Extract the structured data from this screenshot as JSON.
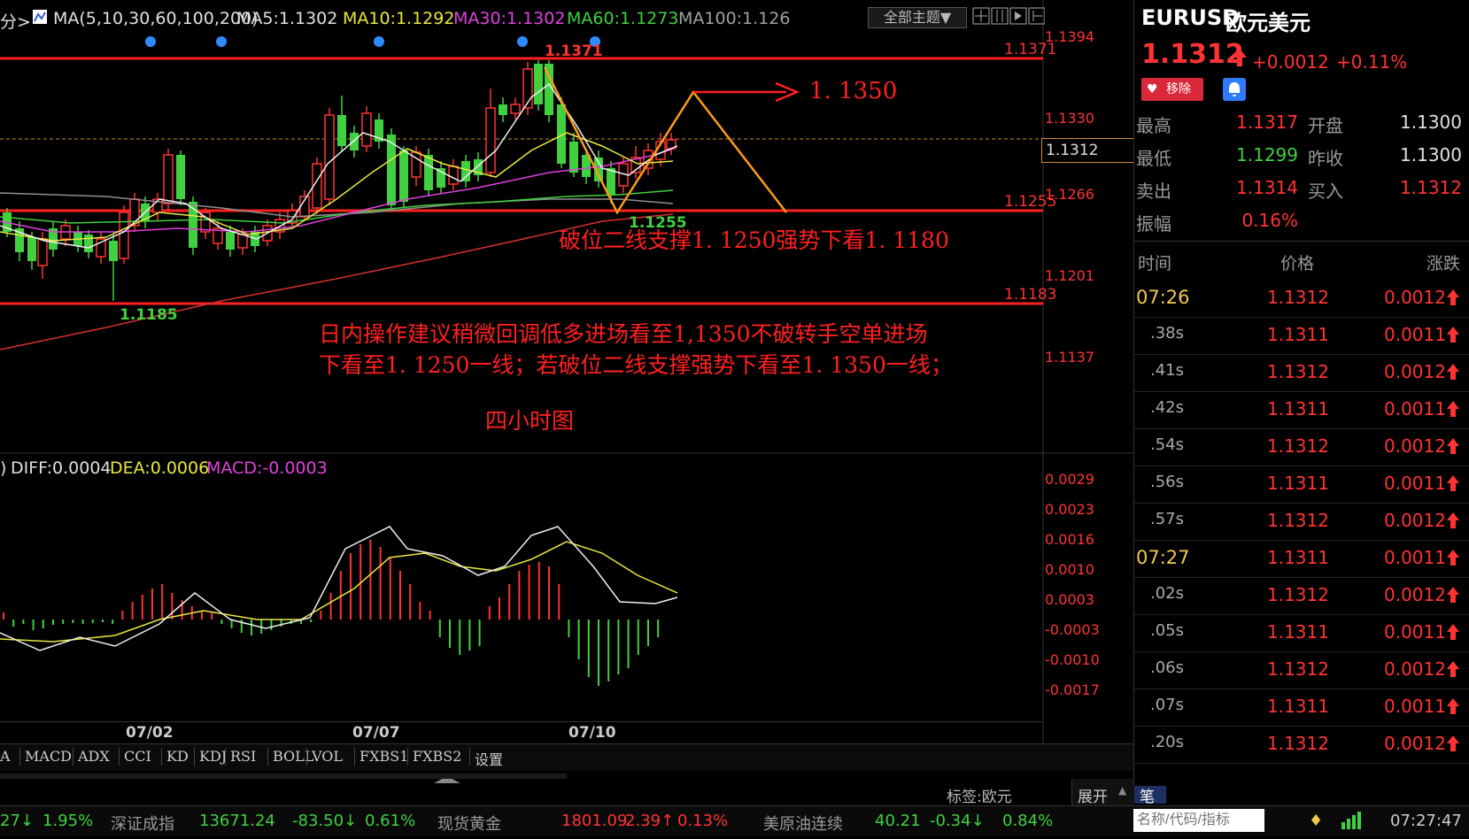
{
  "ma_legend": {
    "prefix": "分>",
    "items": [
      {
        "text": "MA(5,10,30,60,100,200)",
        "color": "#e0e0e0"
      },
      {
        "text": "MA5:1.1302",
        "color": "#e0e0e0"
      },
      {
        "text": "MA10:1.1292",
        "color": "#e8e840"
      },
      {
        "text": "MA30:1.1302",
        "color": "#e040e0"
      },
      {
        "text": "MA60:1.1273",
        "color": "#40d040"
      },
      {
        "text": "MA100:1.126",
        "color": "#a0a0a0"
      }
    ],
    "theme_button": "全部主题▼"
  },
  "macd_legend": {
    "prefix": ")",
    "items": [
      {
        "text": "DIFF:0.0004",
        "color": "#e0e0e0"
      },
      {
        "text": "DEA:0.0006",
        "color": "#e8e840"
      },
      {
        "text": "MACD:-0.0003",
        "color": "#e040e0"
      }
    ]
  },
  "price_axis": [
    "1.1394",
    "1.1330",
    "1.1266",
    "1.1201",
    "1.1137"
  ],
  "current_price_tag": "1.1312",
  "macd_axis": [
    "0.0029",
    "0.0023",
    "0.0016",
    "0.0010",
    "0.0003",
    "-0.0003",
    "-0.0010",
    "-0.0017"
  ],
  "date_axis": [
    "07/02",
    "07/07",
    "07/10"
  ],
  "levels": {
    "top": "1.1371",
    "top_high_label": "1.1371",
    "mid": "1.1255",
    "mid_low_label": "1.1255",
    "bottom": "1.1183",
    "low_label": "1.1185"
  },
  "annotations": {
    "target": "1. 1350",
    "break_note": "破位二线支撑1. 1250强势下看1. 1180",
    "advice_line1": "日内操作建议稍微回调低多进场看至1,1350不破转手空单进场",
    "advice_line2": "下看至1. 1250一线；若破位二线支撑强势下看至1. 1350一线；",
    "chart_type": "四小时图"
  },
  "tabs": [
    "A",
    "MACD",
    "ADX",
    "CCI",
    "KD",
    "KDJ",
    "RSI",
    "BOLL",
    "VOL",
    "FXBS1",
    "FXBS2",
    "设置"
  ],
  "tag_bar": {
    "label": "标签:欧元",
    "expand": "展开",
    "pen": "笔"
  },
  "quote": {
    "symbol": "EURUSD",
    "name": "欧元美元",
    "price": "1.1312",
    "change": "+0.0012",
    "change_pct": "+0.11%",
    "remove_btn": "移除",
    "stats": [
      {
        "label": "最高",
        "value": "1.1317",
        "color": "#ff3333",
        "label2": "开盘",
        "value2": "1.1300",
        "color2": "#e0e0e0"
      },
      {
        "label": "最低",
        "value": "1.1299",
        "color": "#40d040",
        "label2": "昨收",
        "value2": "1.1300",
        "color2": "#e0e0e0"
      },
      {
        "label": "卖出",
        "value": "1.1314",
        "color": "#ff3333",
        "label2": "买入",
        "value2": "1.1312",
        "color2": "#ff3333"
      },
      {
        "label": "振幅",
        "value": "0.16%",
        "color": "#ff3333",
        "label2": "",
        "value2": "",
        "color2": "#e0e0e0"
      }
    ]
  },
  "ticks_header": {
    "time": "时间",
    "price": "价格",
    "change": "涨跌"
  },
  "ticks": [
    {
      "time": "07:26",
      "major": true,
      "price": "1.1312",
      "change": "0.0012"
    },
    {
      "time": ".38s",
      "major": false,
      "price": "1.1311",
      "change": "0.0011"
    },
    {
      "time": ".41s",
      "major": false,
      "price": "1.1312",
      "change": "0.0012"
    },
    {
      "time": ".42s",
      "major": false,
      "price": "1.1311",
      "change": "0.0011"
    },
    {
      "time": ".54s",
      "major": false,
      "price": "1.1312",
      "change": "0.0012"
    },
    {
      "time": ".56s",
      "major": false,
      "price": "1.1311",
      "change": "0.0011"
    },
    {
      "time": ".57s",
      "major": false,
      "price": "1.1312",
      "change": "0.0012"
    },
    {
      "time": "07:27",
      "major": true,
      "price": "1.1311",
      "change": "0.0011"
    },
    {
      "time": ".02s",
      "major": false,
      "price": "1.1312",
      "change": "0.0012"
    },
    {
      "time": ".05s",
      "major": false,
      "price": "1.1311",
      "change": "0.0011"
    },
    {
      "time": ".06s",
      "major": false,
      "price": "1.1312",
      "change": "0.0012"
    },
    {
      "time": ".07s",
      "major": false,
      "price": "1.1311",
      "change": "0.0011"
    },
    {
      "time": ".20s",
      "major": false,
      "price": "1.1312",
      "change": "0.0012"
    }
  ],
  "ticker": [
    {
      "text": "27↓",
      "color": "#40d040"
    },
    {
      "text": "1.95%",
      "color": "#40d040"
    },
    {
      "text": "深证成指",
      "color": "#999999"
    },
    {
      "text": "13671.24",
      "color": "#40d040"
    },
    {
      "text": "-83.50↓",
      "color": "#40d040"
    },
    {
      "text": "0.61%",
      "color": "#40d040"
    },
    {
      "text": "现货黄金",
      "color": "#999999"
    },
    {
      "text": "1801.09",
      "color": "#ff3333"
    },
    {
      "text": "2.39↑",
      "color": "#ff3333"
    },
    {
      "text": "0.13%",
      "color": "#ff3333"
    },
    {
      "text": "美原油连续",
      "color": "#999999"
    },
    {
      "text": "40.21",
      "color": "#40d040"
    },
    {
      "text": "-0.34↓",
      "color": "#40d040"
    },
    {
      "text": "0.84%",
      "color": "#40d040"
    }
  ],
  "search": {
    "placeholder": "名称/代码/指标"
  },
  "clock": "07:27:47"
}
